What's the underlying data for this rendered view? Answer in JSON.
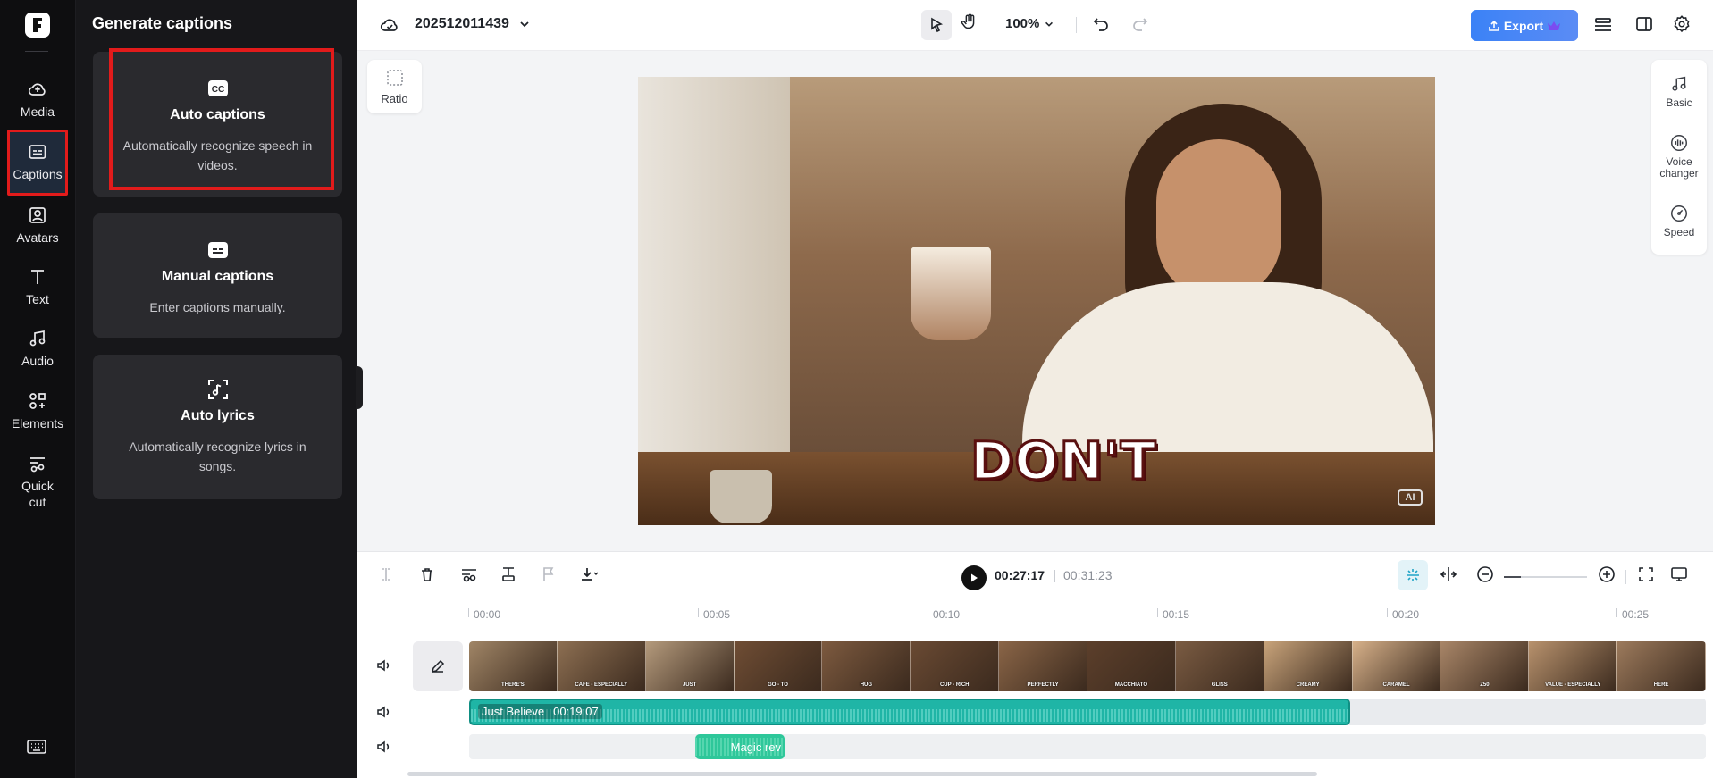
{
  "project": {
    "name": "202512011439",
    "zoom": "100%"
  },
  "toolbar": {
    "export_label": "Export"
  },
  "nav": {
    "items": [
      {
        "label": "Media"
      },
      {
        "label": "Captions"
      },
      {
        "label": "Avatars"
      },
      {
        "label": "Text"
      },
      {
        "label": "Audio"
      },
      {
        "label": "Elements"
      },
      {
        "label": "Quick cut"
      }
    ]
  },
  "panel": {
    "title": "Generate captions",
    "cards": [
      {
        "title": "Auto captions",
        "desc": "Automatically recognize speech in videos."
      },
      {
        "title": "Manual captions",
        "desc": "Enter captions manually."
      },
      {
        "title": "Auto lyrics",
        "desc": "Automatically recognize lyrics in songs."
      }
    ]
  },
  "canvas": {
    "ratio_label": "Ratio",
    "caption_text": "DON'T",
    "ai_badge": "AI"
  },
  "right_rail": {
    "items": [
      {
        "label": "Basic"
      },
      {
        "label": "Voice changer"
      },
      {
        "label": "Speed"
      }
    ]
  },
  "timeline": {
    "current_time": "00:27:17",
    "total_time": "00:31:23",
    "zoom_level": 0.2,
    "ruler": [
      "00:00",
      "00:05",
      "00:10",
      "00:15",
      "00:20",
      "00:25"
    ],
    "thumb_captions": [
      "THERE'S",
      "CAFE - ESPECIALLY",
      "JUST",
      "GO - TO",
      "HUG",
      "CUP - RICH",
      "PERFECTLY",
      "MACCHIATO",
      "GLISS",
      "CREAMY",
      "CARAMEL",
      "Z50",
      "VALUE - ESPECIALLY",
      "HERE"
    ],
    "audio_track": {
      "name": "Just Believe",
      "duration": "00:19:07"
    },
    "sfx_track": {
      "name": "Magic rev"
    }
  },
  "colors": {
    "accent": "#3b82f6",
    "highlight": "#e21b1b",
    "audio": "#1fb5a6"
  }
}
